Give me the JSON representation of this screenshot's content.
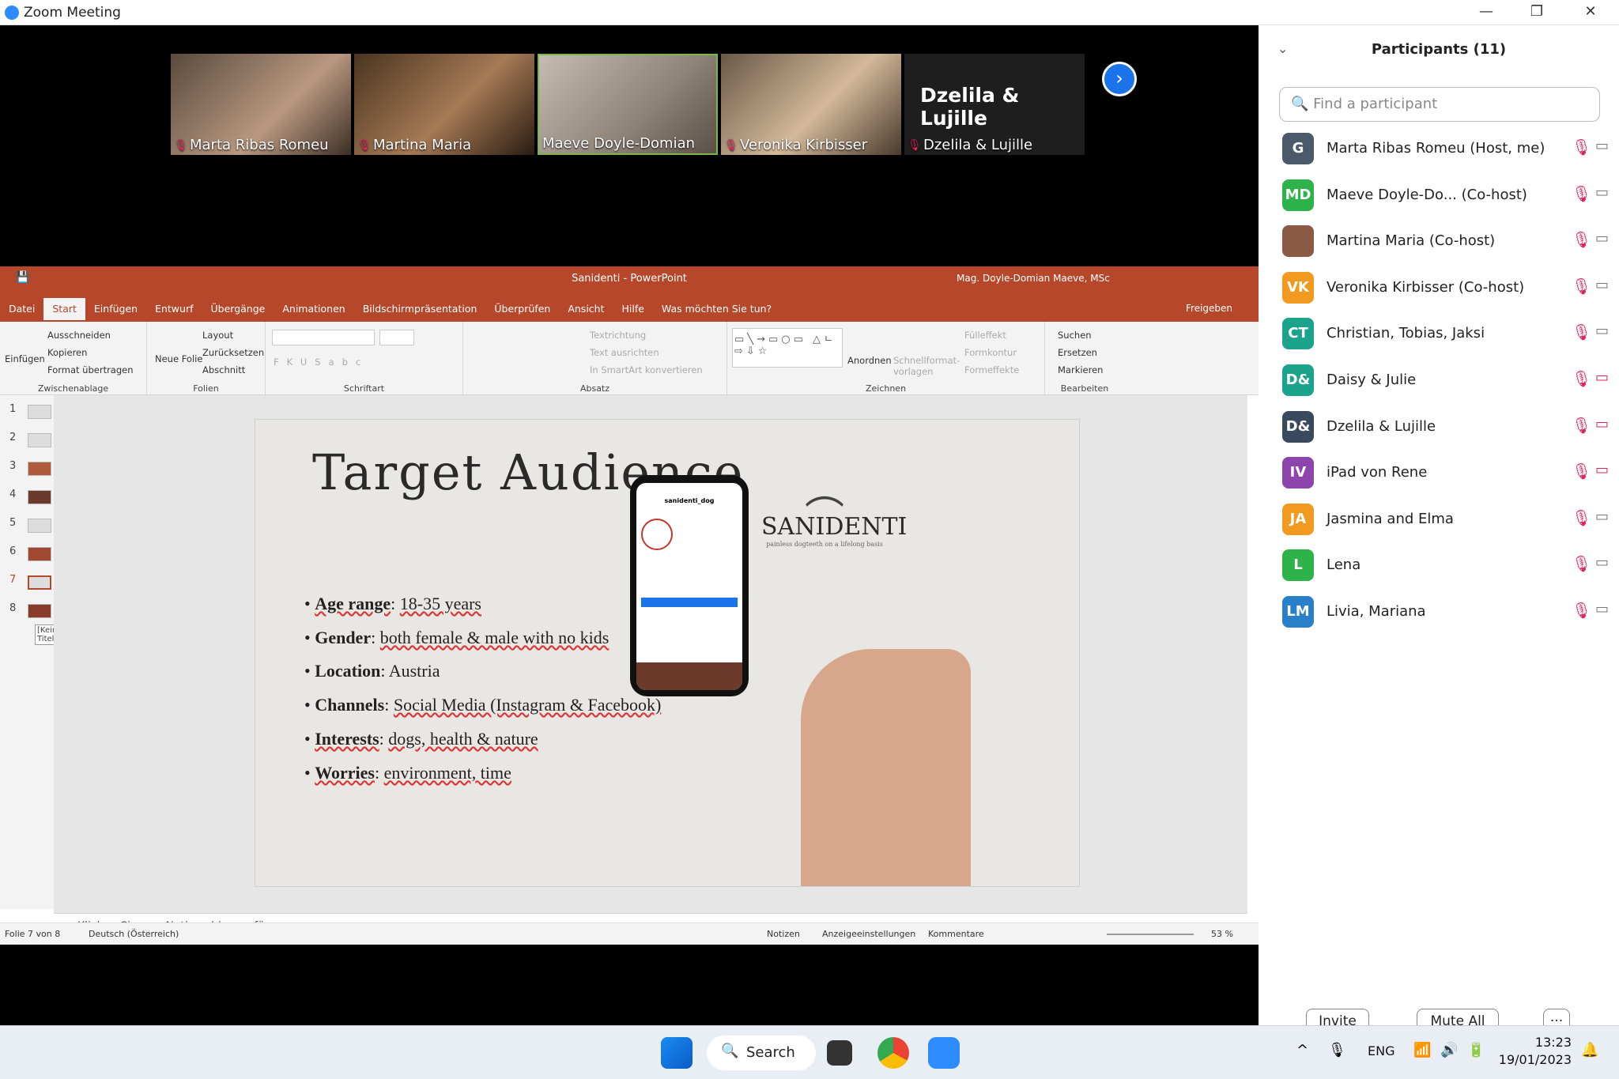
{
  "window": {
    "title": "Zoom Meeting",
    "min": "—",
    "max": "❐",
    "close": "✕"
  },
  "tiles": [
    {
      "name": "Marta Ribas Romeu",
      "bg": "#6d5a4a"
    },
    {
      "name": "Martina Maria",
      "bg": "#7b5b3d"
    },
    {
      "name": "Maeve Doyle-Domian",
      "bg": "#8a7f74"
    },
    {
      "name": "Veronika Kirbisser",
      "bg": "#9a8e7e"
    },
    {
      "name": "Dzelila & Lujille",
      "bg": "#1e1e1e",
      "big": "Dzelila & Lujille"
    }
  ],
  "ppt": {
    "title": "Sanidenti - PowerPoint",
    "user": "Mag. Doyle-Domian Maeve, MSc",
    "tabs": [
      "Datei",
      "Start",
      "Einfügen",
      "Entwurf",
      "Übergänge",
      "Animationen",
      "Bildschirmpräsentation",
      "Überprüfen",
      "Ansicht",
      "Hilfe",
      "Was möchten Sie tun?"
    ],
    "share": "Freigeben",
    "ribbon": {
      "clipboard": {
        "paste": "Einfügen",
        "cut": "Ausschneiden",
        "copy": "Kopieren",
        "format": "Format übertragen",
        "label": "Zwischenablage"
      },
      "slides": {
        "new": "Neue Folie",
        "layout": "Layout",
        "reset": "Zurücksetzen",
        "section": "Abschnitt",
        "label": "Folien"
      },
      "font": {
        "label": "Schriftart"
      },
      "para": {
        "dir": "Textrichtung",
        "align": "Text ausrichten",
        "smart": "In SmartArt konvertieren",
        "label": "Absatz"
      },
      "draw": {
        "arrange": "Anordnen",
        "quick": "Schnellformat-vorlagen",
        "fill": "Fülleffekt",
        "outline": "Formkontur",
        "effects": "Formeffekte",
        "label": "Zeichnen"
      },
      "edit": {
        "find": "Suchen",
        "replace": "Ersetzen",
        "select": "Markieren",
        "label": "Bearbeiten"
      }
    },
    "thumbs": [
      "1",
      "2",
      "3",
      "4",
      "5",
      "6",
      "7",
      "8"
    ],
    "tooltip": "[Kein Titel]",
    "slide": {
      "title": "Target Audience",
      "bullets": [
        {
          "k": "Age range",
          "v": "18-35 years"
        },
        {
          "k": "Gender",
          "v": "both female & male with no kids"
        },
        {
          "k": "Location",
          "v": "Austria"
        },
        {
          "k": "Channels",
          "v": "Social Media (Instagram & Facebook)"
        },
        {
          "k": "Interests",
          "v": "dogs, health & nature"
        },
        {
          "k": "Worries",
          "v": "environment, time"
        }
      ],
      "logo": "SANIDENTI",
      "logo_sub": "painless dogteeth on a lifelong basis",
      "phone_user": "sanidenti_dog"
    },
    "notes": "Klicken Sie, um Notizen hinzuzufügen",
    "status": {
      "slide": "Folie 7 von 8",
      "lang": "Deutsch (Österreich)",
      "notes": "Notizen",
      "display": "Anzeigeeinstellungen",
      "comments": "Kommentare",
      "zoom": "53 %"
    }
  },
  "participants": {
    "title": "Participants (11)",
    "search_placeholder": "Find a participant",
    "list": [
      {
        "initials": "G",
        "name": "Marta Ribas Romeu (Host, me)",
        "color": "#4a5a6a",
        "video": "on"
      },
      {
        "initials": "MD",
        "name": "Maeve Doyle-Do...   (Co-host)",
        "color": "#2eb34a",
        "video": "on"
      },
      {
        "initials": "",
        "name": "Martina Maria (Co-host)",
        "color": "#8a5a45",
        "video": "on"
      },
      {
        "initials": "VK",
        "name": "Veronika Kirbisser (Co-host)",
        "color": "#f29a1f",
        "video": "on"
      },
      {
        "initials": "CT",
        "name": "Christian, Tobias, Jaksi",
        "color": "#1ba38c",
        "video": "on"
      },
      {
        "initials": "D&",
        "name": "Daisy & Julie",
        "color": "#1ba38c",
        "video": "off"
      },
      {
        "initials": "D&",
        "name": "Dzelila & Lujille",
        "color": "#3a4a5e",
        "video": "off"
      },
      {
        "initials": "IV",
        "name": "iPad von Rene",
        "color": "#8e44ad",
        "video": "off"
      },
      {
        "initials": "JA",
        "name": "Jasmina and Elma",
        "color": "#f29a1f",
        "video": "on"
      },
      {
        "initials": "L",
        "name": "Lena",
        "color": "#2eb34a",
        "video": "on"
      },
      {
        "initials": "LM",
        "name": "Livia, Mariana",
        "color": "#2a7fc9",
        "video": "on"
      }
    ],
    "invite": "Invite",
    "mute_all": "Mute All",
    "more": "···"
  },
  "taskbar": {
    "search": "Search",
    "lang": "ENG",
    "time": "13:23",
    "date": "19/01/2023"
  }
}
